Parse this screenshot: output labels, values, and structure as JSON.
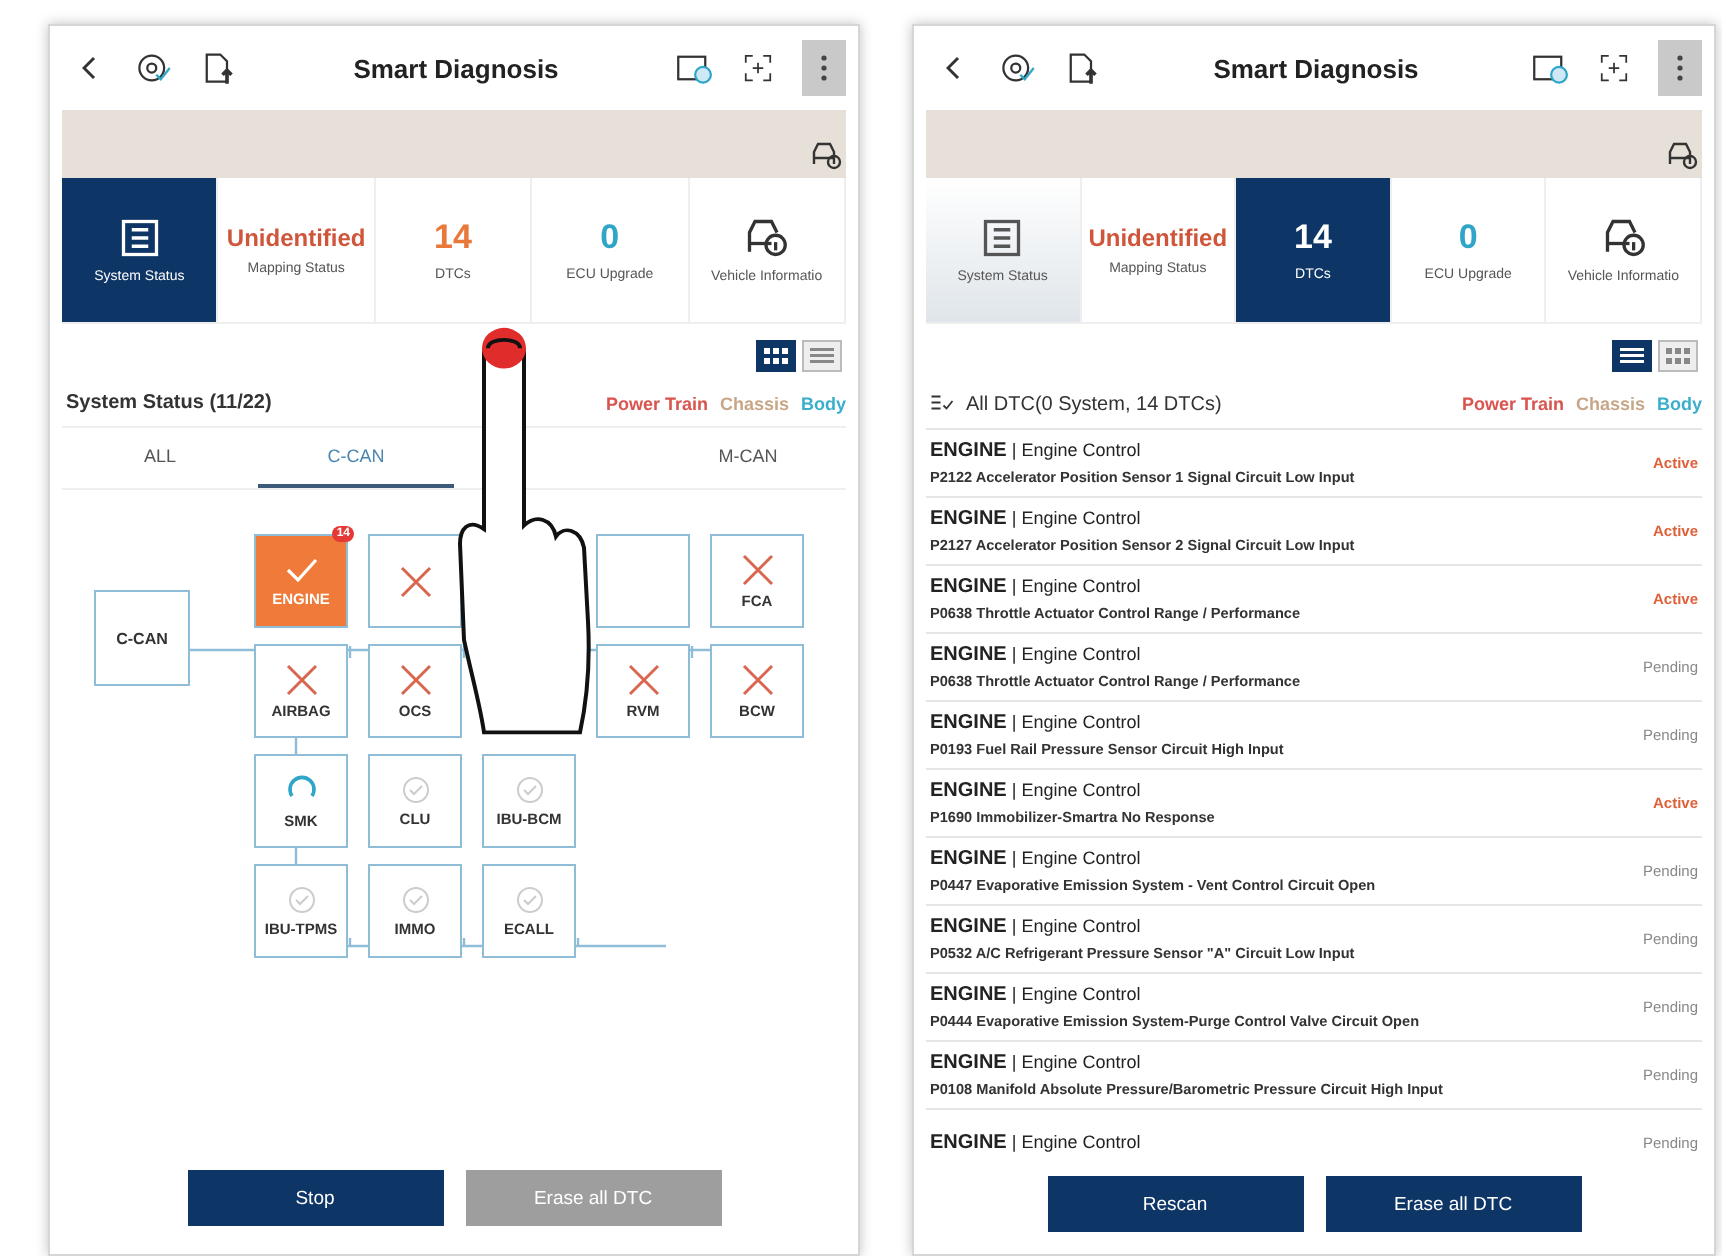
{
  "screens": [
    {
      "kind": "diagram",
      "title": "Smart Diagnosis",
      "tiles": [
        {
          "kind": "icon",
          "label": "System Status",
          "selected": true
        },
        {
          "kind": "text",
          "value": "Unidentified",
          "label": "Mapping Status",
          "selected": false,
          "color": "#d0563b"
        },
        {
          "kind": "text",
          "value": "14",
          "label": "DTCs",
          "selected": false,
          "color": "#e8793a"
        },
        {
          "kind": "text",
          "value": "0",
          "label": "ECU Upgrade",
          "selected": false,
          "color": "#2fa6c8"
        },
        {
          "kind": "car",
          "label": "Vehicle Informatio",
          "selected": false
        }
      ],
      "view_modes": [
        {
          "kind": "grid",
          "selected": true
        },
        {
          "kind": "list",
          "selected": false
        }
      ],
      "heading": "System Status (11/22)",
      "filters": [
        {
          "label": "Power Train",
          "color": "#d9534f"
        },
        {
          "label": "Chassis",
          "color": "#c8a688"
        },
        {
          "label": "Body",
          "color": "#3aaecb"
        }
      ],
      "tabs": [
        {
          "label": "ALL",
          "selected": false
        },
        {
          "label": "C-CAN",
          "selected": true
        },
        {
          "label": "M-CAN",
          "selected": false
        }
      ],
      "bus": "C-CAN",
      "modules": [
        [
          {
            "label": "ENGINE",
            "kind": "dtc",
            "badge": "14"
          },
          {
            "kind": "fail"
          },
          {
            "kind": "covered"
          },
          {
            "kind": "blank"
          },
          {
            "label": "FCA",
            "kind": "fail"
          }
        ],
        [
          {
            "label": "AIRBAG",
            "kind": "fail"
          },
          {
            "label": "OCS",
            "kind": "fail"
          },
          {
            "kind": "covered"
          },
          {
            "label": "RVM",
            "kind": "fail"
          },
          {
            "label": "BCW",
            "kind": "fail"
          }
        ],
        [
          {
            "label": "SMK",
            "kind": "scanning"
          },
          {
            "label": "CLU",
            "kind": "ok"
          },
          {
            "label": "IBU-BCM",
            "kind": "ok"
          }
        ],
        [
          {
            "label": "IBU-TPMS",
            "kind": "ok"
          },
          {
            "label": "IMMO",
            "kind": "ok"
          },
          {
            "label": "ECALL",
            "kind": "ok"
          }
        ]
      ],
      "buttons": [
        {
          "label": "Stop",
          "disabled": false
        },
        {
          "label": "Erase all DTC",
          "disabled": true
        }
      ]
    },
    {
      "kind": "dtc_list",
      "title": "Smart Diagnosis",
      "tiles": [
        {
          "kind": "icon",
          "label": "System Status",
          "selected": false
        },
        {
          "kind": "text",
          "value": "Unidentified",
          "label": "Mapping Status",
          "selected": false,
          "color": "#d0563b"
        },
        {
          "kind": "text",
          "value": "14",
          "label": "DTCs",
          "selected": true
        },
        {
          "kind": "text",
          "value": "0",
          "label": "ECU Upgrade",
          "selected": false,
          "color": "#2fa6c8"
        },
        {
          "kind": "car",
          "label": "Vehicle Informatio",
          "selected": false
        }
      ],
      "view_modes": [
        {
          "kind": "list",
          "selected": true
        },
        {
          "kind": "grid",
          "selected": false
        }
      ],
      "heading": "All DTC(0 System, 14 DTCs)",
      "filters": [
        {
          "label": "Power Train",
          "color": "#d9534f"
        },
        {
          "label": "Chassis",
          "color": "#c8a688"
        },
        {
          "label": "Body",
          "color": "#3aaecb"
        }
      ],
      "dtcs": [
        {
          "module": "ENGINE",
          "separator": "|",
          "system": "Engine Control",
          "description": "P2122 Accelerator Position Sensor 1 Signal Circuit Low Input",
          "status": "Active",
          "active": true
        },
        {
          "module": "ENGINE",
          "separator": "|",
          "system": "Engine Control",
          "description": "P2127 Accelerator Position Sensor 2 Signal Circuit Low Input",
          "status": "Active",
          "active": true
        },
        {
          "module": "ENGINE",
          "separator": "|",
          "system": "Engine Control",
          "description": "P0638 Throttle Actuator Control Range / Performance",
          "status": "Active",
          "active": true
        },
        {
          "module": "ENGINE",
          "separator": "|",
          "system": "Engine Control",
          "description": "P0638 Throttle Actuator Control Range / Performance",
          "status": "Pending",
          "active": false
        },
        {
          "module": "ENGINE",
          "separator": "|",
          "system": "Engine Control",
          "description": "P0193 Fuel Rail Pressure Sensor Circuit High Input",
          "status": "Pending",
          "active": false
        },
        {
          "module": "ENGINE",
          "separator": "|",
          "system": "Engine Control",
          "description": "P1690 Immobilizer-Smartra No Response",
          "status": "Active",
          "active": true
        },
        {
          "module": "ENGINE",
          "separator": "|",
          "system": "Engine Control",
          "description": "P0447 Evaporative Emission System - Vent Control Circuit Open",
          "status": "Pending",
          "active": false
        },
        {
          "module": "ENGINE",
          "separator": "|",
          "system": "Engine Control",
          "description": "P0532 A/C Refrigerant Pressure Sensor \"A\" Circuit Low Input",
          "status": "Pending",
          "active": false
        },
        {
          "module": "ENGINE",
          "separator": "|",
          "system": "Engine Control",
          "description": "P0444 Evaporative Emission System-Purge Control Valve Circuit Open",
          "status": "Pending",
          "active": false
        },
        {
          "module": "ENGINE",
          "separator": "|",
          "system": "Engine Control",
          "description": "P0108 Manifold Absolute Pressure/Barometric Pressure Circuit High Input",
          "status": "Pending",
          "active": false
        },
        {
          "module": "ENGINE",
          "separator": "|",
          "system": "Engine Control",
          "status": "Pending",
          "active": false
        }
      ],
      "buttons": [
        {
          "label": "Rescan",
          "disabled": false
        },
        {
          "label": "Erase all DTC",
          "disabled": false
        }
      ]
    }
  ]
}
